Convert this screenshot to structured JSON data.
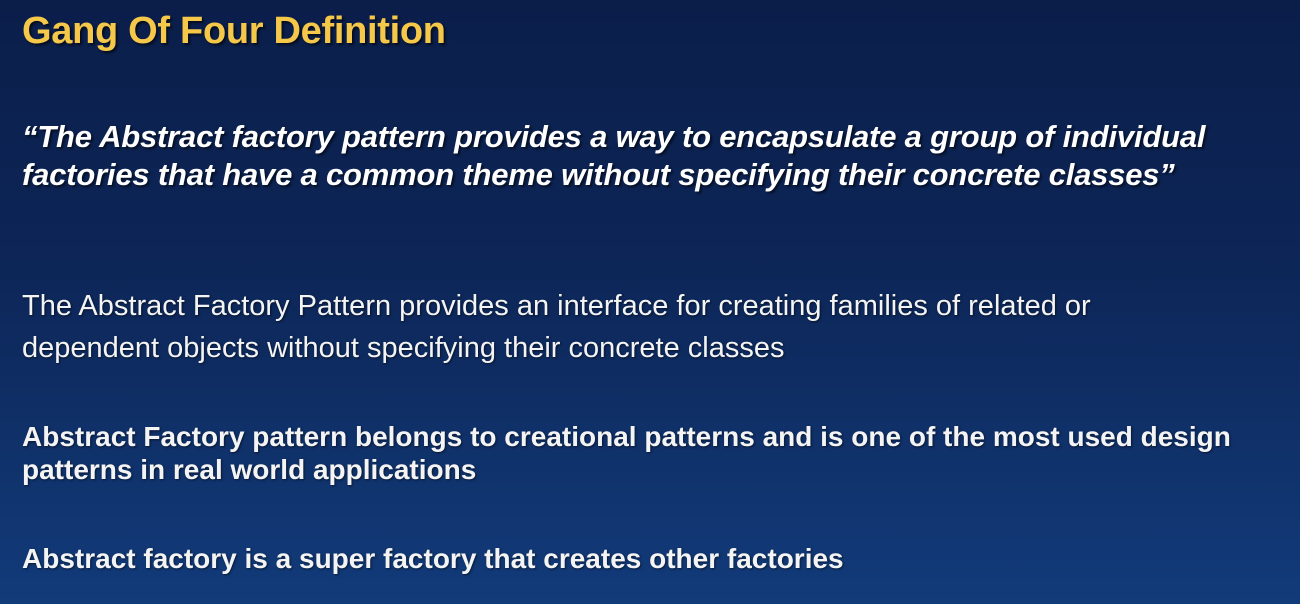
{
  "slide": {
    "title": "Gang Of Four Definition",
    "quote": "“The Abstract factory pattern provides a way to encapsulate a group of individual factories that have a common theme without specifying their concrete classes”",
    "paragraphs": [
      "The Abstract Factory Pattern provides an interface for creating families of related or dependent objects without specifying their concrete classes",
      "Abstract Factory pattern belongs to creational patterns and is one of the most used design patterns in real world applications",
      "Abstract factory is a super factory that creates other factories"
    ]
  },
  "colors": {
    "title": "#f5c84a",
    "text": "#ffffff",
    "background_top": "#0b1e4a",
    "background_bottom": "#123b7a"
  }
}
